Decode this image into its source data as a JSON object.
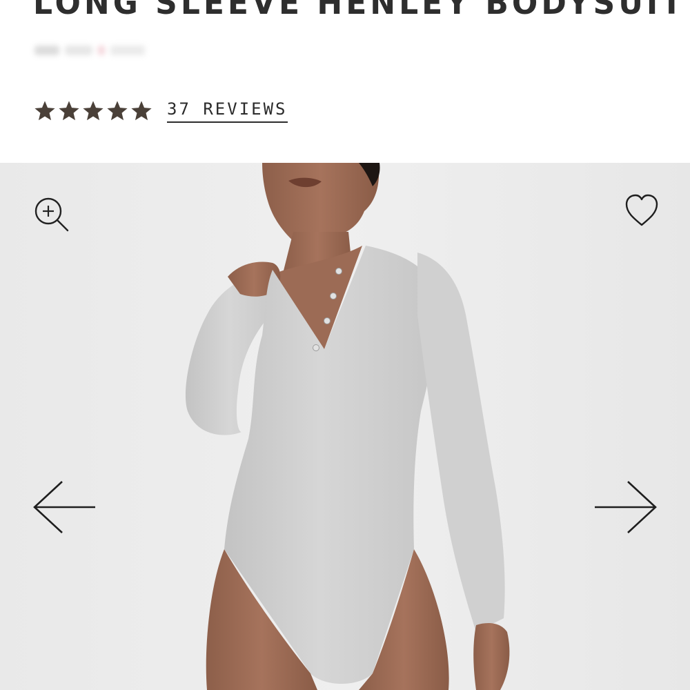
{
  "product": {
    "title": "LONG SLEEVE HENLEY BODYSUIT",
    "rating": 5,
    "rating_max": 5,
    "reviews_label": "37 REVIEWS"
  },
  "colors": {
    "star": "#4a4038",
    "text": "#2b2b2b",
    "gallery_bg": "#e6e6e6",
    "garment": "#cfcfcf",
    "skin": "#a0705a"
  },
  "icons": {
    "zoom": "zoom-in-icon",
    "wishlist": "heart-icon",
    "prev": "arrow-left-icon",
    "next": "arrow-right-icon"
  }
}
